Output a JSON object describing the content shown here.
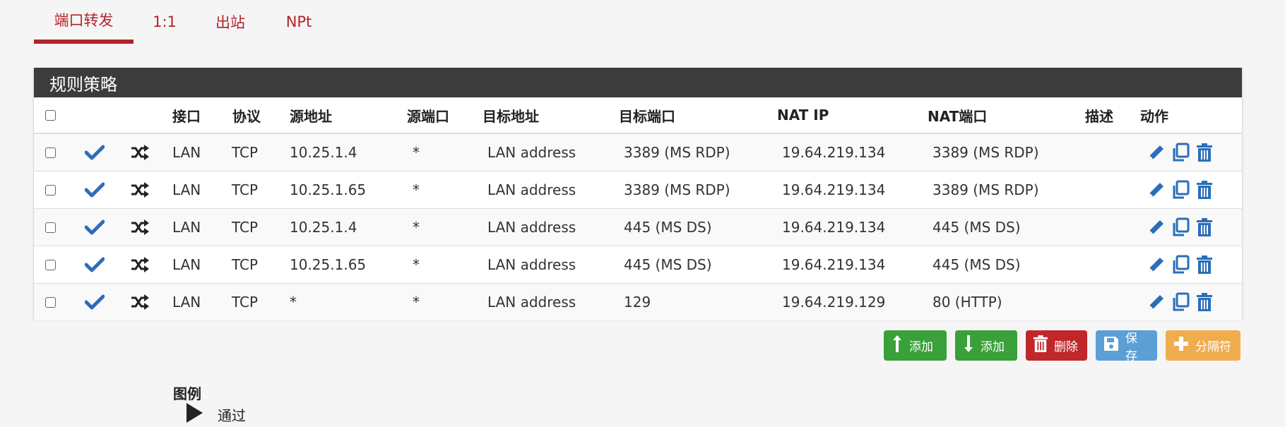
{
  "tabs": [
    {
      "label": "端口转发",
      "active": true
    },
    {
      "label": "1:1",
      "active": false
    },
    {
      "label": "出站",
      "active": false
    },
    {
      "label": "NPt",
      "active": false
    }
  ],
  "panel": {
    "title": "规则策略"
  },
  "columns": {
    "interface": "接口",
    "protocol": "协议",
    "source_address": "源地址",
    "source_port": "源端口",
    "dest_address": "目标地址",
    "dest_port": "目标端口",
    "nat_ip": "NAT IP",
    "nat_port": "NAT端口",
    "description": "描述",
    "actions": "动作"
  },
  "rows": [
    {
      "interface": "LAN",
      "protocol": "TCP",
      "source_address": "10.25.1.4",
      "source_port": "*",
      "dest_address": "LAN address",
      "dest_port": "3389 (MS RDP)",
      "nat_ip": "19.64.219.134",
      "nat_port": "3389 (MS RDP)",
      "description": ""
    },
    {
      "interface": "LAN",
      "protocol": "TCP",
      "source_address": "10.25.1.65",
      "source_port": "*",
      "dest_address": "LAN address",
      "dest_port": "3389 (MS RDP)",
      "nat_ip": "19.64.219.134",
      "nat_port": "3389 (MS RDP)",
      "description": ""
    },
    {
      "interface": "LAN",
      "protocol": "TCP",
      "source_address": "10.25.1.4",
      "source_port": "*",
      "dest_address": "LAN address",
      "dest_port": "445 (MS DS)",
      "nat_ip": "19.64.219.134",
      "nat_port": "445 (MS DS)",
      "description": ""
    },
    {
      "interface": "LAN",
      "protocol": "TCP",
      "source_address": "10.25.1.65",
      "source_port": "*",
      "dest_address": "LAN address",
      "dest_port": "445 (MS DS)",
      "nat_ip": "19.64.219.134",
      "nat_port": "445 (MS DS)",
      "description": ""
    },
    {
      "interface": "LAN",
      "protocol": "TCP",
      "source_address": "*",
      "source_port": "*",
      "dest_address": "LAN address",
      "dest_port": "129",
      "nat_ip": "19.64.219.129",
      "nat_port": "80 (HTTP)",
      "description": ""
    }
  ],
  "buttons": {
    "add_top": "添加",
    "add_bottom": "添加",
    "delete": "删除",
    "save": "保存",
    "separator": "分隔符"
  },
  "legend": {
    "title": "图例",
    "pass": "通过"
  },
  "icons": {
    "enabled": "check-icon",
    "nat": "shuffle-icon",
    "edit": "pencil-icon",
    "copy": "copy-icon",
    "delete": "trash-icon"
  },
  "colors": {
    "accent": "#b5232b",
    "panel_header": "#3c3c3c",
    "icon_blue": "#2a6ebb",
    "success": "#3aa039",
    "danger": "#c1262b",
    "info": "#5c9fd6",
    "warning": "#f0ad4e"
  }
}
